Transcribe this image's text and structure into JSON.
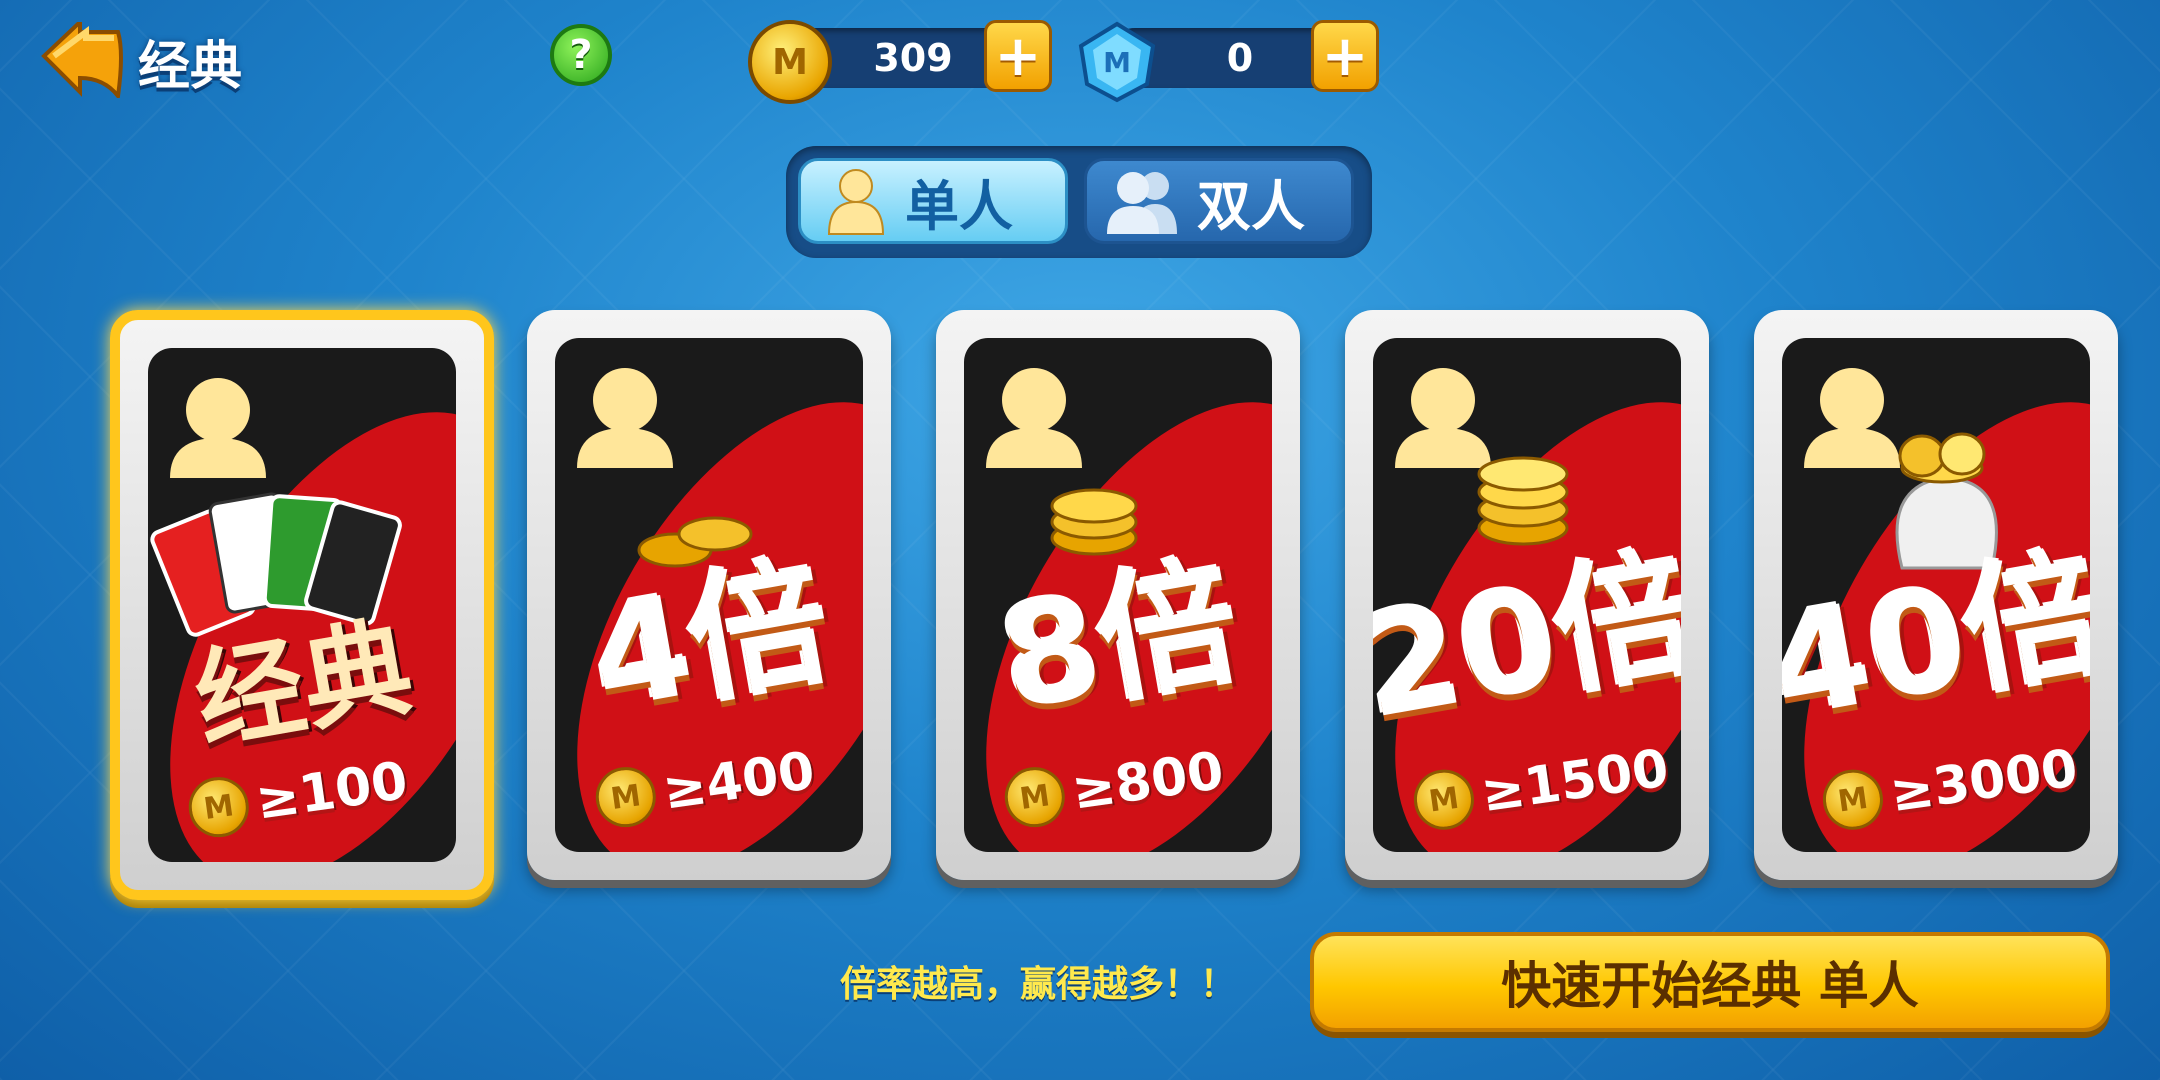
{
  "header": {
    "back_icon": "back-arrow-icon",
    "title": "经典",
    "help_label": "?"
  },
  "resources": {
    "coins": "309",
    "gems": "0",
    "plus_label": "+"
  },
  "tabs": [
    {
      "label": "单人",
      "active": true
    },
    {
      "label": "双人",
      "active": false
    }
  ],
  "cards": [
    {
      "label": "经典",
      "requirement": "≥100",
      "selected": true
    },
    {
      "label": "4倍",
      "requirement": "≥400",
      "selected": false
    },
    {
      "label": "8倍",
      "requirement": "≥800",
      "selected": false
    },
    {
      "label": "20倍",
      "requirement": "≥1500",
      "selected": false
    },
    {
      "label": "40倍",
      "requirement": "≥3000",
      "selected": false
    }
  ],
  "footer": {
    "hint": "倍率越高，赢得越多！！",
    "start_button": "快速开始经典 单人"
  },
  "colors": {
    "accent_yellow": "#ffc61c",
    "card_red": "#d01016",
    "background_blue": "#1f84cc"
  }
}
